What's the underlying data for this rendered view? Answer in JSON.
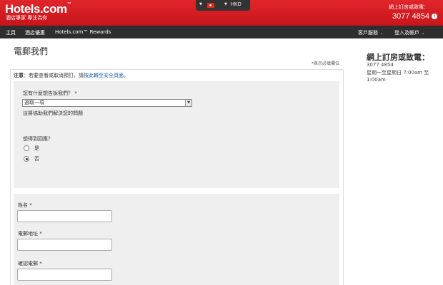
{
  "header": {
    "logo_text": "Hotels.com",
    "logo_tm": "™",
    "tagline": "酒店專家 專注為你",
    "currency": "HKD",
    "phone_label": "網上訂房或致電：",
    "phone_number": "3077 4854",
    "info_icon": "i",
    "colors": {
      "brand_red": "#d32f2f",
      "nav_bg": "#2e2e2e",
      "link": "#1a5fa8"
    }
  },
  "nav": {
    "home": "主頁",
    "deals": "酒店優惠",
    "rewards": "Hotels.com™ Rewards",
    "customer_service": "客戶服務",
    "sign_in": "登入及帳戶"
  },
  "page": {
    "title": "電郵我們",
    "required_note": "*表示必填欄位",
    "notice_label": "注意",
    "notice_text": "：若要查看或取消預訂，請",
    "notice_link": "按此轉至安全頁面",
    "notice_end": "。"
  },
  "form": {
    "q1_label": "您有什麼想告訴我們？ *",
    "q1_selected": "選取一項",
    "q1_help": "這將協助我們解決您的問題",
    "q2_label": "想得到回應？",
    "radio_yes": "是",
    "radio_no": "否",
    "radio_selected": "否",
    "name_label": "姓名 *",
    "email_label": "電郵地址 *",
    "confirm_email_label": "確認電郵 *",
    "name_value": "",
    "email_value": "",
    "confirm_email_value": ""
  },
  "sidebar": {
    "title": "網上訂房或致電：",
    "phone": "3077 4854",
    "hours": "星期一至星期日 7:00am 至 1:00am"
  }
}
